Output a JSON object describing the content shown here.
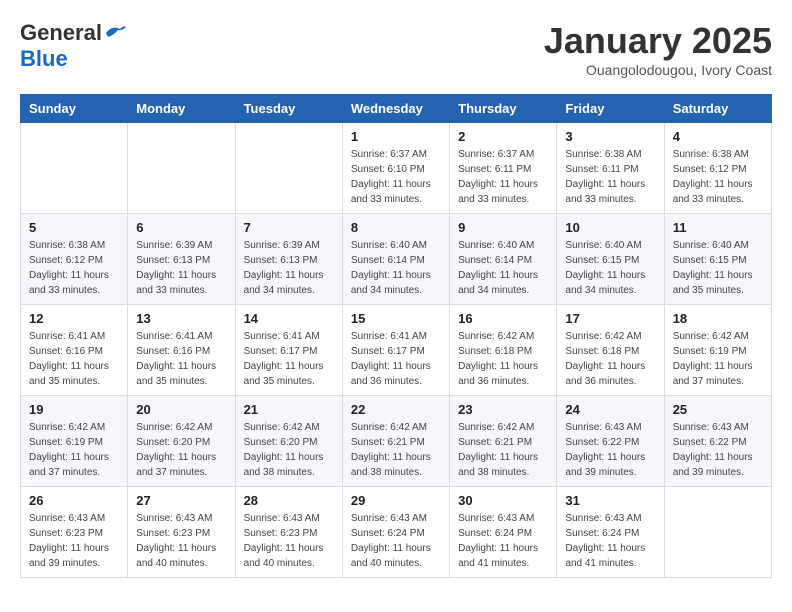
{
  "logo": {
    "general": "General",
    "blue": "Blue"
  },
  "title": "January 2025",
  "subtitle": "Ouangolodougou, Ivory Coast",
  "days_header": [
    "Sunday",
    "Monday",
    "Tuesday",
    "Wednesday",
    "Thursday",
    "Friday",
    "Saturday"
  ],
  "weeks": [
    [
      {
        "day": "",
        "info": ""
      },
      {
        "day": "",
        "info": ""
      },
      {
        "day": "",
        "info": ""
      },
      {
        "day": "1",
        "info": "Sunrise: 6:37 AM\nSunset: 6:10 PM\nDaylight: 11 hours and 33 minutes."
      },
      {
        "day": "2",
        "info": "Sunrise: 6:37 AM\nSunset: 6:11 PM\nDaylight: 11 hours and 33 minutes."
      },
      {
        "day": "3",
        "info": "Sunrise: 6:38 AM\nSunset: 6:11 PM\nDaylight: 11 hours and 33 minutes."
      },
      {
        "day": "4",
        "info": "Sunrise: 6:38 AM\nSunset: 6:12 PM\nDaylight: 11 hours and 33 minutes."
      }
    ],
    [
      {
        "day": "5",
        "info": "Sunrise: 6:38 AM\nSunset: 6:12 PM\nDaylight: 11 hours and 33 minutes."
      },
      {
        "day": "6",
        "info": "Sunrise: 6:39 AM\nSunset: 6:13 PM\nDaylight: 11 hours and 33 minutes."
      },
      {
        "day": "7",
        "info": "Sunrise: 6:39 AM\nSunset: 6:13 PM\nDaylight: 11 hours and 34 minutes."
      },
      {
        "day": "8",
        "info": "Sunrise: 6:40 AM\nSunset: 6:14 PM\nDaylight: 11 hours and 34 minutes."
      },
      {
        "day": "9",
        "info": "Sunrise: 6:40 AM\nSunset: 6:14 PM\nDaylight: 11 hours and 34 minutes."
      },
      {
        "day": "10",
        "info": "Sunrise: 6:40 AM\nSunset: 6:15 PM\nDaylight: 11 hours and 34 minutes."
      },
      {
        "day": "11",
        "info": "Sunrise: 6:40 AM\nSunset: 6:15 PM\nDaylight: 11 hours and 35 minutes."
      }
    ],
    [
      {
        "day": "12",
        "info": "Sunrise: 6:41 AM\nSunset: 6:16 PM\nDaylight: 11 hours and 35 minutes."
      },
      {
        "day": "13",
        "info": "Sunrise: 6:41 AM\nSunset: 6:16 PM\nDaylight: 11 hours and 35 minutes."
      },
      {
        "day": "14",
        "info": "Sunrise: 6:41 AM\nSunset: 6:17 PM\nDaylight: 11 hours and 35 minutes."
      },
      {
        "day": "15",
        "info": "Sunrise: 6:41 AM\nSunset: 6:17 PM\nDaylight: 11 hours and 36 minutes."
      },
      {
        "day": "16",
        "info": "Sunrise: 6:42 AM\nSunset: 6:18 PM\nDaylight: 11 hours and 36 minutes."
      },
      {
        "day": "17",
        "info": "Sunrise: 6:42 AM\nSunset: 6:18 PM\nDaylight: 11 hours and 36 minutes."
      },
      {
        "day": "18",
        "info": "Sunrise: 6:42 AM\nSunset: 6:19 PM\nDaylight: 11 hours and 37 minutes."
      }
    ],
    [
      {
        "day": "19",
        "info": "Sunrise: 6:42 AM\nSunset: 6:19 PM\nDaylight: 11 hours and 37 minutes."
      },
      {
        "day": "20",
        "info": "Sunrise: 6:42 AM\nSunset: 6:20 PM\nDaylight: 11 hours and 37 minutes."
      },
      {
        "day": "21",
        "info": "Sunrise: 6:42 AM\nSunset: 6:20 PM\nDaylight: 11 hours and 38 minutes."
      },
      {
        "day": "22",
        "info": "Sunrise: 6:42 AM\nSunset: 6:21 PM\nDaylight: 11 hours and 38 minutes."
      },
      {
        "day": "23",
        "info": "Sunrise: 6:42 AM\nSunset: 6:21 PM\nDaylight: 11 hours and 38 minutes."
      },
      {
        "day": "24",
        "info": "Sunrise: 6:43 AM\nSunset: 6:22 PM\nDaylight: 11 hours and 39 minutes."
      },
      {
        "day": "25",
        "info": "Sunrise: 6:43 AM\nSunset: 6:22 PM\nDaylight: 11 hours and 39 minutes."
      }
    ],
    [
      {
        "day": "26",
        "info": "Sunrise: 6:43 AM\nSunset: 6:23 PM\nDaylight: 11 hours and 39 minutes."
      },
      {
        "day": "27",
        "info": "Sunrise: 6:43 AM\nSunset: 6:23 PM\nDaylight: 11 hours and 40 minutes."
      },
      {
        "day": "28",
        "info": "Sunrise: 6:43 AM\nSunset: 6:23 PM\nDaylight: 11 hours and 40 minutes."
      },
      {
        "day": "29",
        "info": "Sunrise: 6:43 AM\nSunset: 6:24 PM\nDaylight: 11 hours and 40 minutes."
      },
      {
        "day": "30",
        "info": "Sunrise: 6:43 AM\nSunset: 6:24 PM\nDaylight: 11 hours and 41 minutes."
      },
      {
        "day": "31",
        "info": "Sunrise: 6:43 AM\nSunset: 6:24 PM\nDaylight: 11 hours and 41 minutes."
      },
      {
        "day": "",
        "info": ""
      }
    ]
  ]
}
